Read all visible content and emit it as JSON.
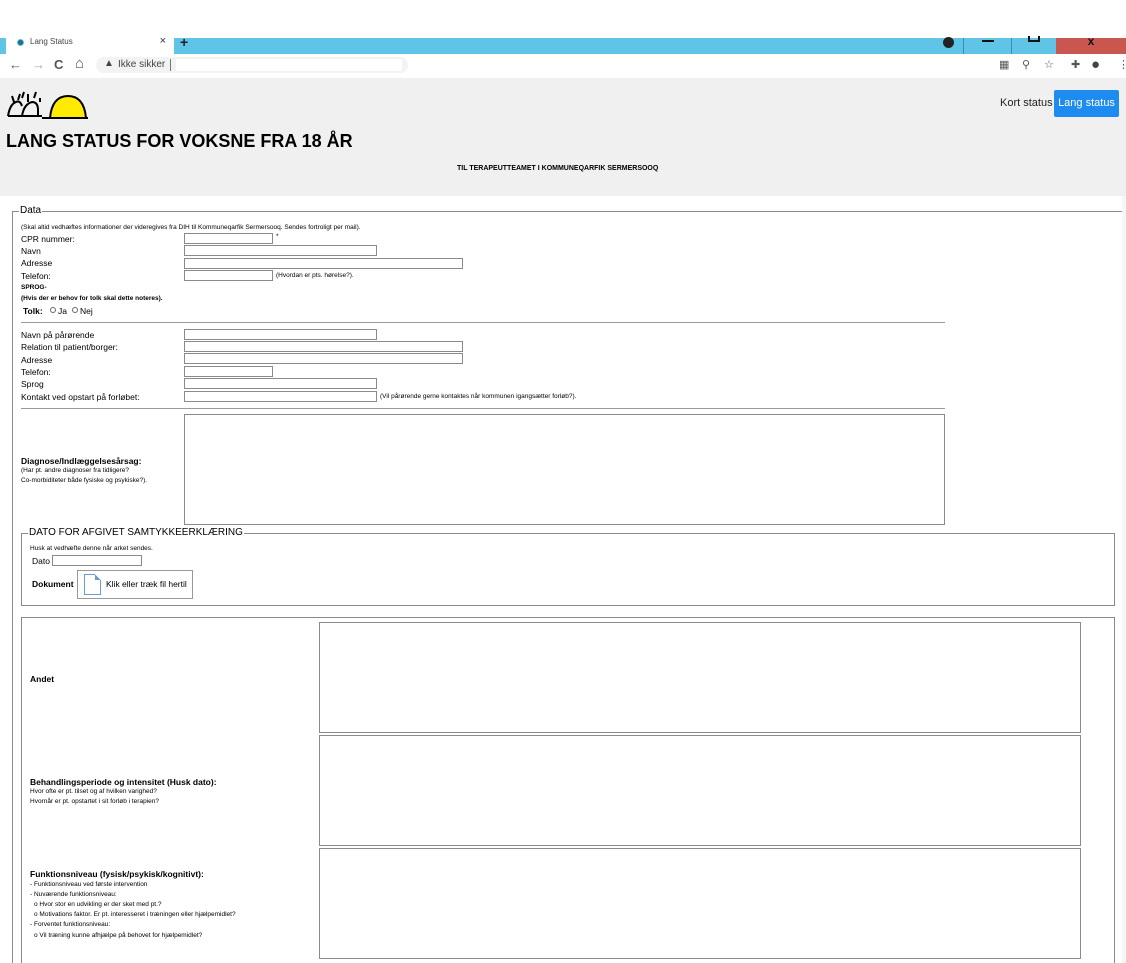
{
  "browser": {
    "tab_title": "Lang Status",
    "tab_close": "×",
    "new_tab": "+",
    "back": "←",
    "forward": "→",
    "reload": "C",
    "home": "⌂",
    "security_warning_icon": "▲",
    "security_text": "Ikke sikker",
    "window_close": "x"
  },
  "header": {
    "title": "LANG STATUS FOR VOKSNE FRA 18 ÅR",
    "subtitle": "TIL TERAPEUTTEAMET I KOMMUNEQARFIK SERMERSOOQ",
    "nav_short": "Kort status",
    "nav_long": "Lang status",
    "accent": "#1e8bf0"
  },
  "data_section": {
    "legend": "Data",
    "note": "(Skal altid vedhæftes informationer der videregives fra DIH til Kommuneqarfik Sermersooq. Sendes fortroligt per mail).",
    "cpr_label": "CPR nummer:",
    "required_mark": "*",
    "name_label": "Navn",
    "address_label": "Adresse",
    "phone_label": "Telefon:",
    "phone_hint": "(Hvordan er pts. hørelse?).",
    "language_heading": "SPROG-",
    "language_note": "(Hvis der er behov for tolk skal dette noteres).",
    "interpreter_label": "Tolk:",
    "option_yes": "Ja",
    "option_no": "Nej"
  },
  "relative_section": {
    "name_label": "Navn på pårørende",
    "relation_label": "Relation til patient/borger:",
    "address_label": "Adresse",
    "phone_label": "Telefon:",
    "language_label": "Sprog",
    "contact_label": "Kontakt ved opstart på forløbet:",
    "contact_hint": "(Vil pårørende gerne kontaktes når kommunen igangsætter forløb?)."
  },
  "diagnosis": {
    "label": "Diagnose/Indlæggelsesårsag:",
    "hint_1": "(Har pt. andre diagnoser fra tidligere?",
    "hint_2": "Co-morbiditeter både fysiske og psykiske?)."
  },
  "consent": {
    "legend": "DATO FOR AFGIVET SAMTYKKEERKLÆRING",
    "note": "Husk at vedhæfte denne når arket sendes.",
    "date_label": "Dato",
    "document_label": "Dokument",
    "upload_text": "Klik eller træk fil hertil"
  },
  "details": {
    "other_label": "Andet",
    "treatment_label": "Behandlingsperiode og intensitet (Husk dato):",
    "treatment_hint_1": "Hvor ofte er pt. tilset og af hvilken varighed?",
    "treatment_hint_2": "Hvornår er pt. opstartet i sit forløb i terapien?",
    "function_label": "Funktionsniveau (fysisk/psykisk/kognitivt):",
    "function_hint_1": "- Funktionsniveau ved første intervention",
    "function_hint_2": "- Nuværende funktionsniveau:",
    "function_hint_3": "o Hvor stor en udvikling er der sket med pt.?",
    "function_hint_4": "o Motivations faktor. Er pt. interesseret i træningen eller hjælpemidlet?",
    "function_hint_5": "- Forventet funktionsniveau:",
    "function_hint_6": "o Vil træning kunne afhjælpe på behovet for hjælpemidlet?"
  }
}
